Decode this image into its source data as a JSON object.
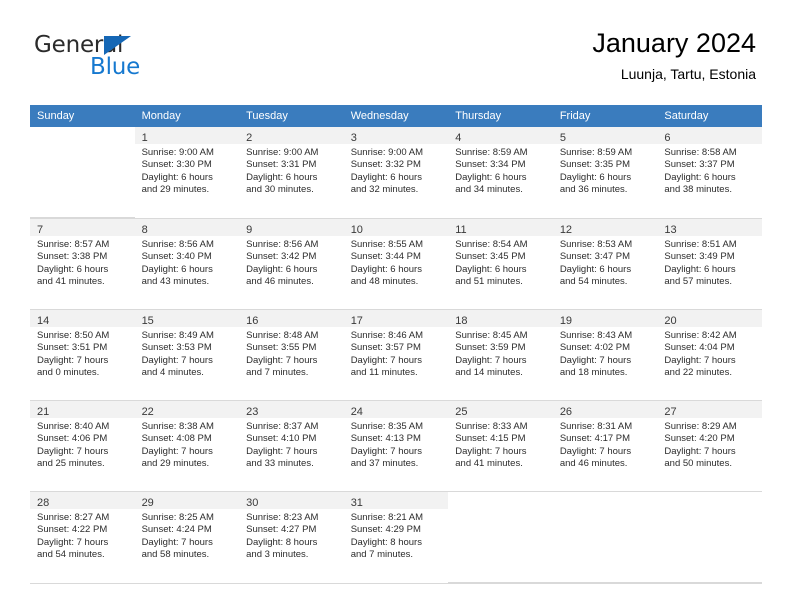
{
  "brand": {
    "name_part1": "General",
    "name_part2": "Blue",
    "accent_color": "#1578cf",
    "triangle_color": "#1567b5"
  },
  "header": {
    "title": "January 2024",
    "subtitle": "Luunja, Tartu, Estonia"
  },
  "calendar": {
    "header_bg": "#3a7cbe",
    "header_text_color": "#ffffff",
    "daynum_band_bg": "#f2f2f2",
    "weekdays": [
      "Sunday",
      "Monday",
      "Tuesday",
      "Wednesday",
      "Thursday",
      "Friday",
      "Saturday"
    ],
    "weeks": [
      [
        {
          "day": "",
          "lines": []
        },
        {
          "day": "1",
          "lines": [
            "Sunrise: 9:00 AM",
            "Sunset: 3:30 PM",
            "Daylight: 6 hours",
            "and 29 minutes."
          ]
        },
        {
          "day": "2",
          "lines": [
            "Sunrise: 9:00 AM",
            "Sunset: 3:31 PM",
            "Daylight: 6 hours",
            "and 30 minutes."
          ]
        },
        {
          "day": "3",
          "lines": [
            "Sunrise: 9:00 AM",
            "Sunset: 3:32 PM",
            "Daylight: 6 hours",
            "and 32 minutes."
          ]
        },
        {
          "day": "4",
          "lines": [
            "Sunrise: 8:59 AM",
            "Sunset: 3:34 PM",
            "Daylight: 6 hours",
            "and 34 minutes."
          ]
        },
        {
          "day": "5",
          "lines": [
            "Sunrise: 8:59 AM",
            "Sunset: 3:35 PM",
            "Daylight: 6 hours",
            "and 36 minutes."
          ]
        },
        {
          "day": "6",
          "lines": [
            "Sunrise: 8:58 AM",
            "Sunset: 3:37 PM",
            "Daylight: 6 hours",
            "and 38 minutes."
          ]
        }
      ],
      [
        {
          "day": "7",
          "lines": [
            "Sunrise: 8:57 AM",
            "Sunset: 3:38 PM",
            "Daylight: 6 hours",
            "and 41 minutes."
          ]
        },
        {
          "day": "8",
          "lines": [
            "Sunrise: 8:56 AM",
            "Sunset: 3:40 PM",
            "Daylight: 6 hours",
            "and 43 minutes."
          ]
        },
        {
          "day": "9",
          "lines": [
            "Sunrise: 8:56 AM",
            "Sunset: 3:42 PM",
            "Daylight: 6 hours",
            "and 46 minutes."
          ]
        },
        {
          "day": "10",
          "lines": [
            "Sunrise: 8:55 AM",
            "Sunset: 3:44 PM",
            "Daylight: 6 hours",
            "and 48 minutes."
          ]
        },
        {
          "day": "11",
          "lines": [
            "Sunrise: 8:54 AM",
            "Sunset: 3:45 PM",
            "Daylight: 6 hours",
            "and 51 minutes."
          ]
        },
        {
          "day": "12",
          "lines": [
            "Sunrise: 8:53 AM",
            "Sunset: 3:47 PM",
            "Daylight: 6 hours",
            "and 54 minutes."
          ]
        },
        {
          "day": "13",
          "lines": [
            "Sunrise: 8:51 AM",
            "Sunset: 3:49 PM",
            "Daylight: 6 hours",
            "and 57 minutes."
          ]
        }
      ],
      [
        {
          "day": "14",
          "lines": [
            "Sunrise: 8:50 AM",
            "Sunset: 3:51 PM",
            "Daylight: 7 hours",
            "and 0 minutes."
          ]
        },
        {
          "day": "15",
          "lines": [
            "Sunrise: 8:49 AM",
            "Sunset: 3:53 PM",
            "Daylight: 7 hours",
            "and 4 minutes."
          ]
        },
        {
          "day": "16",
          "lines": [
            "Sunrise: 8:48 AM",
            "Sunset: 3:55 PM",
            "Daylight: 7 hours",
            "and 7 minutes."
          ]
        },
        {
          "day": "17",
          "lines": [
            "Sunrise: 8:46 AM",
            "Sunset: 3:57 PM",
            "Daylight: 7 hours",
            "and 11 minutes."
          ]
        },
        {
          "day": "18",
          "lines": [
            "Sunrise: 8:45 AM",
            "Sunset: 3:59 PM",
            "Daylight: 7 hours",
            "and 14 minutes."
          ]
        },
        {
          "day": "19",
          "lines": [
            "Sunrise: 8:43 AM",
            "Sunset: 4:02 PM",
            "Daylight: 7 hours",
            "and 18 minutes."
          ]
        },
        {
          "day": "20",
          "lines": [
            "Sunrise: 8:42 AM",
            "Sunset: 4:04 PM",
            "Daylight: 7 hours",
            "and 22 minutes."
          ]
        }
      ],
      [
        {
          "day": "21",
          "lines": [
            "Sunrise: 8:40 AM",
            "Sunset: 4:06 PM",
            "Daylight: 7 hours",
            "and 25 minutes."
          ]
        },
        {
          "day": "22",
          "lines": [
            "Sunrise: 8:38 AM",
            "Sunset: 4:08 PM",
            "Daylight: 7 hours",
            "and 29 minutes."
          ]
        },
        {
          "day": "23",
          "lines": [
            "Sunrise: 8:37 AM",
            "Sunset: 4:10 PM",
            "Daylight: 7 hours",
            "and 33 minutes."
          ]
        },
        {
          "day": "24",
          "lines": [
            "Sunrise: 8:35 AM",
            "Sunset: 4:13 PM",
            "Daylight: 7 hours",
            "and 37 minutes."
          ]
        },
        {
          "day": "25",
          "lines": [
            "Sunrise: 8:33 AM",
            "Sunset: 4:15 PM",
            "Daylight: 7 hours",
            "and 41 minutes."
          ]
        },
        {
          "day": "26",
          "lines": [
            "Sunrise: 8:31 AM",
            "Sunset: 4:17 PM",
            "Daylight: 7 hours",
            "and 46 minutes."
          ]
        },
        {
          "day": "27",
          "lines": [
            "Sunrise: 8:29 AM",
            "Sunset: 4:20 PM",
            "Daylight: 7 hours",
            "and 50 minutes."
          ]
        }
      ],
      [
        {
          "day": "28",
          "lines": [
            "Sunrise: 8:27 AM",
            "Sunset: 4:22 PM",
            "Daylight: 7 hours",
            "and 54 minutes."
          ]
        },
        {
          "day": "29",
          "lines": [
            "Sunrise: 8:25 AM",
            "Sunset: 4:24 PM",
            "Daylight: 7 hours",
            "and 58 minutes."
          ]
        },
        {
          "day": "30",
          "lines": [
            "Sunrise: 8:23 AM",
            "Sunset: 4:27 PM",
            "Daylight: 8 hours",
            "and 3 minutes."
          ]
        },
        {
          "day": "31",
          "lines": [
            "Sunrise: 8:21 AM",
            "Sunset: 4:29 PM",
            "Daylight: 8 hours",
            "and 7 minutes."
          ]
        },
        {
          "day": "",
          "lines": []
        },
        {
          "day": "",
          "lines": []
        },
        {
          "day": "",
          "lines": []
        }
      ]
    ]
  }
}
